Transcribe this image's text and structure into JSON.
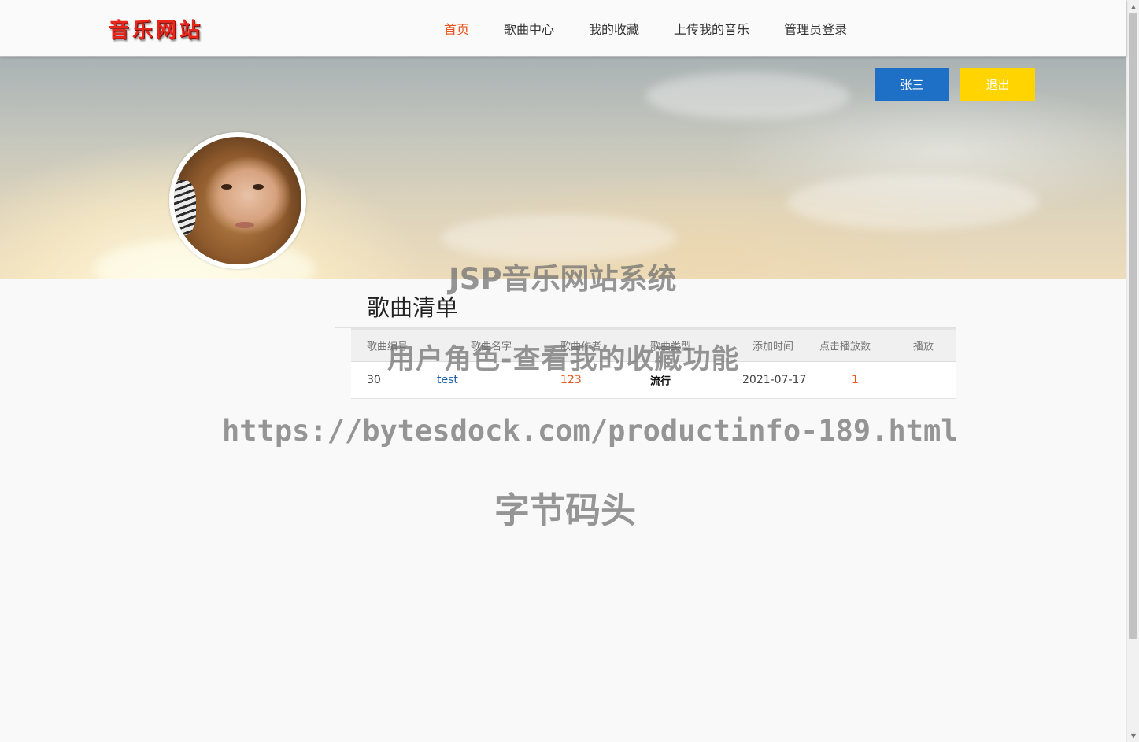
{
  "header": {
    "logo_text": "音乐网站",
    "nav": [
      {
        "label": "首页",
        "active": true
      },
      {
        "label": "歌曲中心",
        "active": false
      },
      {
        "label": "我的收藏",
        "active": false
      },
      {
        "label": "上传我的音乐",
        "active": false
      },
      {
        "label": "管理员登录",
        "active": false
      }
    ]
  },
  "banner": {
    "user_button": "张三",
    "logout_button": "退出",
    "avatar_icon": "avatar"
  },
  "list": {
    "title": "歌曲清单",
    "columns": [
      "歌曲编号",
      "歌曲名字",
      "歌曲作者",
      "歌曲类型",
      "添加时间",
      "点击播放数",
      "播放"
    ],
    "rows": [
      {
        "id": "30",
        "name": "test",
        "artist": "123",
        "type": "流行",
        "date": "2021-07-17",
        "plays": "1",
        "play": ""
      }
    ]
  },
  "watermark": {
    "line1": "JSP音乐网站系统",
    "line2": "用户角色-查看我的收藏功能",
    "line3": "https://bytesdock.com/productinfo-189.html",
    "line4": "字节码头"
  },
  "colors": {
    "accent": "#e8541b",
    "link": "#1d5ea5",
    "user_button": "#1e6fc6",
    "logout_button": "#ffd400"
  }
}
